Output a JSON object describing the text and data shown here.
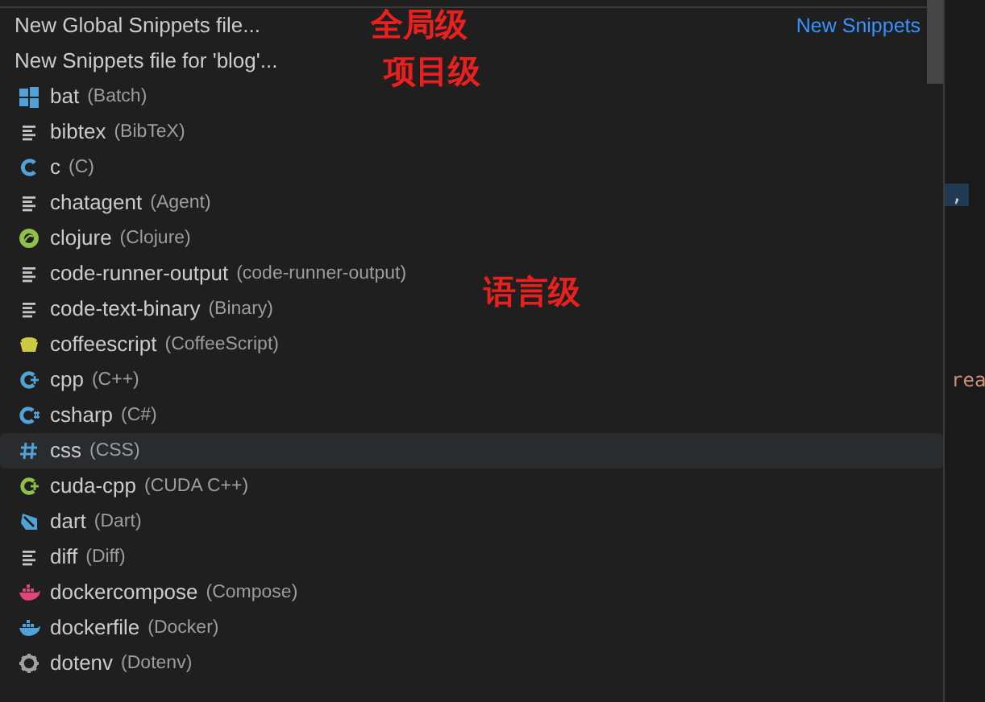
{
  "quick_pick": {
    "header_rows": [
      {
        "label": "New Global Snippets file...",
        "separator_label": "New Snippets"
      },
      {
        "label": "New Snippets file for 'blog'..."
      }
    ],
    "items": [
      {
        "label": "bat",
        "description": "(Batch)",
        "kind": "windows",
        "color": "#4fa3d8",
        "selected": false
      },
      {
        "label": "bibtex",
        "description": "(BibTeX)",
        "kind": "lines",
        "color": "#c5c5c5",
        "selected": false
      },
      {
        "label": "c",
        "description": "(C)",
        "kind": "c",
        "color": "#4fa3d8",
        "selected": false
      },
      {
        "label": "chatagent",
        "description": "(Agent)",
        "kind": "lines",
        "color": "#c5c5c5",
        "selected": false
      },
      {
        "label": "clojure",
        "description": "(Clojure)",
        "kind": "clojure",
        "color": "#8dc149",
        "selected": false
      },
      {
        "label": "code-runner-output",
        "description": "(code-runner-output)",
        "kind": "lines",
        "color": "#c5c5c5",
        "selected": false
      },
      {
        "label": "code-text-binary",
        "description": "(Binary)",
        "kind": "lines",
        "color": "#c5c5c5",
        "selected": false
      },
      {
        "label": "coffeescript",
        "description": "(CoffeeScript)",
        "kind": "cup",
        "color": "#cbcb41",
        "selected": false
      },
      {
        "label": "cpp",
        "description": "(C++)",
        "kind": "cplus",
        "color": "#4fa3d8",
        "selected": false
      },
      {
        "label": "csharp",
        "description": "(C#)",
        "kind": "csharp",
        "color": "#4fa3d8",
        "selected": false
      },
      {
        "label": "css",
        "description": "(CSS)",
        "kind": "hash",
        "color": "#4fa3d8",
        "selected": true
      },
      {
        "label": "cuda-cpp",
        "description": "(CUDA C++)",
        "kind": "cplus",
        "color": "#8dc149",
        "selected": false
      },
      {
        "label": "dart",
        "description": "(Dart)",
        "kind": "dart",
        "color": "#4fa3d8",
        "selected": false
      },
      {
        "label": "diff",
        "description": "(Diff)",
        "kind": "lines",
        "color": "#c5c5c5",
        "selected": false
      },
      {
        "label": "dockercompose",
        "description": "(Compose)",
        "kind": "whale",
        "color": "#e0467a",
        "selected": false
      },
      {
        "label": "dockerfile",
        "description": "(Docker)",
        "kind": "whale",
        "color": "#4fa3d8",
        "selected": false
      },
      {
        "label": "dotenv",
        "description": "(Dotenv)",
        "kind": "gear",
        "color": "#a0a0a0",
        "selected": false
      }
    ]
  },
  "annotations": [
    {
      "text": "全局级"
    },
    {
      "text": "项目级"
    },
    {
      "text": "语言级"
    }
  ],
  "editor_fragments": [
    {
      "text": ",",
      "highlighted": true
    },
    {
      "text": "rea",
      "highlighted": false
    }
  ]
}
